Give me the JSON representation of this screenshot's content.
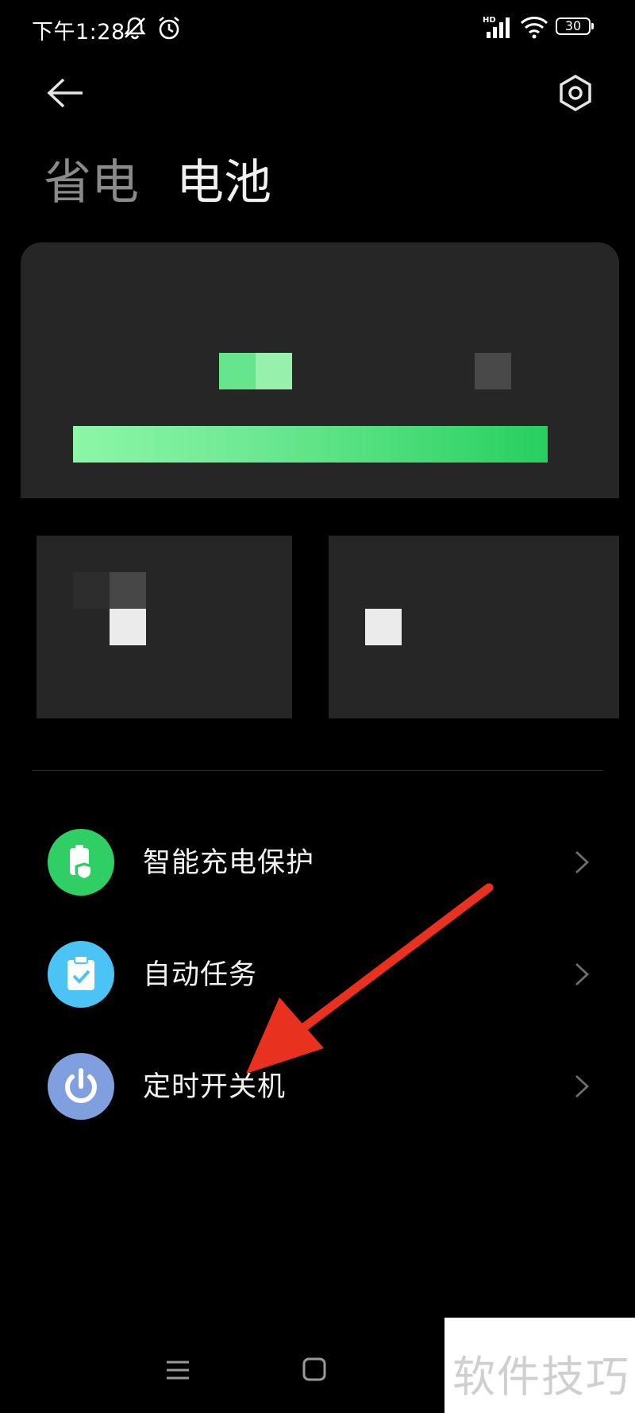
{
  "status_bar": {
    "time": "下午1:28",
    "icons": [
      "bell-off-icon",
      "alarm-icon",
      "hd-signal-icon",
      "wifi-icon"
    ],
    "hd_label": "HD",
    "battery_level": "30"
  },
  "header": {
    "back_icon": "arrow-left-icon",
    "settings_icon": "hexagon-gear-icon",
    "tabs": [
      {
        "label": "省电",
        "active": false
      },
      {
        "label": "电池",
        "active": true
      }
    ]
  },
  "menu": {
    "items": [
      {
        "label": "智能充电保护",
        "icon": "charge-shield-icon",
        "color": "#2fcf65"
      },
      {
        "label": "自动任务",
        "icon": "clipboard-check-icon",
        "color": "#4bc3f5"
      },
      {
        "label": "定时开关机",
        "icon": "power-icon",
        "color": "#7f9fde"
      }
    ]
  },
  "annotation": {
    "arrow_color": "#e8321f"
  },
  "nav_bar": {
    "icons": [
      "menu-lines-icon",
      "home-square-icon"
    ]
  },
  "watermark": {
    "text": "软件技巧"
  }
}
